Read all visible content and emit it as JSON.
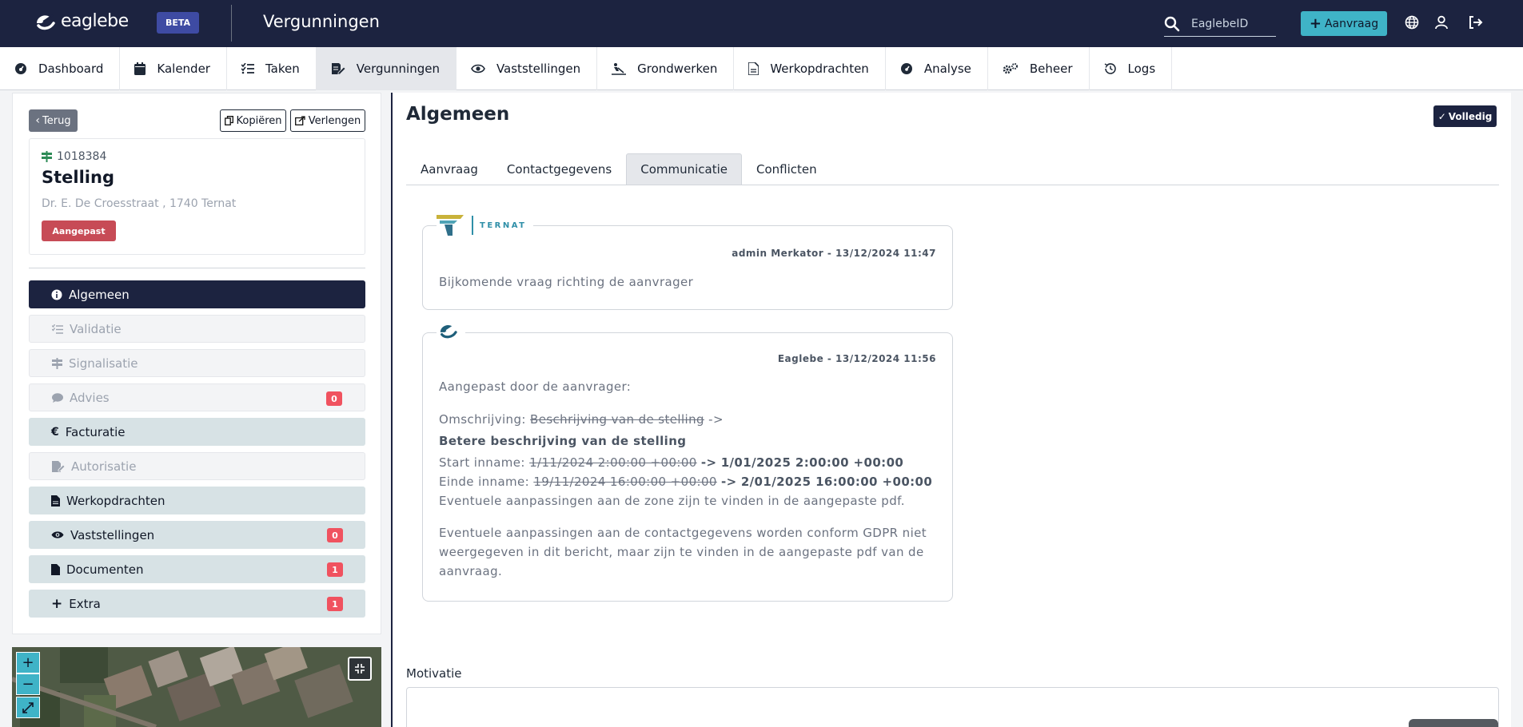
{
  "header": {
    "logo_text": "eaglebe",
    "beta_label": "BETA",
    "app_title": "Vergunningen",
    "search_placeholder": "EaglebeID",
    "aanvraag_button": "Aanvraag",
    "brand_color": "#1c2340",
    "accent_color": "#3fb3c7"
  },
  "nav": {
    "items": [
      {
        "label": "Dashboard",
        "icon": "dashboard-icon"
      },
      {
        "label": "Kalender",
        "icon": "calendar-icon"
      },
      {
        "label": "Taken",
        "icon": "tasks-icon"
      },
      {
        "label": "Vergunningen",
        "icon": "permit-icon",
        "active": true
      },
      {
        "label": "Vaststellingen",
        "icon": "eye-icon"
      },
      {
        "label": "Grondwerken",
        "icon": "digging-icon"
      },
      {
        "label": "Werkopdrachten",
        "icon": "file-icon"
      },
      {
        "label": "Analyse",
        "icon": "gauge-icon"
      },
      {
        "label": "Beheer",
        "icon": "cogs-icon"
      },
      {
        "label": "Logs",
        "icon": "history-icon"
      }
    ]
  },
  "left": {
    "terug_label": "Terug",
    "kopieren_label": "Kopiëren",
    "verlengen_label": "Verlengen",
    "card": {
      "id": "1018384",
      "title": "Stelling",
      "address": "Dr. E. De Croesstraat , 1740 Ternat",
      "status": "Aangepast"
    },
    "menu": [
      {
        "label": "Algemeen",
        "state": "active",
        "icon": "info-icon"
      },
      {
        "label": "Validatie",
        "state": "disabled",
        "icon": "checklist-icon"
      },
      {
        "label": "Signalisatie",
        "state": "disabled",
        "icon": "sign-icon"
      },
      {
        "label": "Advies",
        "state": "disabled",
        "icon": "comment-icon",
        "count": "0"
      },
      {
        "label": "Facturatie",
        "state": "enabled",
        "icon": "euro-icon"
      },
      {
        "label": "Autorisatie",
        "state": "disabled",
        "icon": "file-signature-icon"
      },
      {
        "label": "Werkopdrachten",
        "state": "enabled",
        "icon": "file-icon"
      },
      {
        "label": "Vaststellingen",
        "state": "enabled",
        "icon": "eye-icon",
        "count": "0"
      },
      {
        "label": "Documenten",
        "state": "enabled",
        "icon": "document-icon",
        "count": "1"
      },
      {
        "label": "Extra",
        "state": "enabled",
        "icon": "plus-icon",
        "count": "1"
      }
    ]
  },
  "map": {
    "zoom_in": "+",
    "zoom_out": "−"
  },
  "main": {
    "title": "Algemeen",
    "volledig_label": "Volledig",
    "tabs": [
      {
        "label": "Aanvraag"
      },
      {
        "label": "Contactgegevens"
      },
      {
        "label": "Communicatie",
        "active": true
      },
      {
        "label": "Conflicten"
      }
    ],
    "messages": [
      {
        "logo_text": "TERNAT",
        "meta": "admin Merkator - 13/12/2024 11:47",
        "body": "Bijkomende vraag richting de aanvrager"
      },
      {
        "meta": "Eaglebe - 13/12/2024 11:56",
        "intro": "Aangepast door de aanvrager:",
        "omschrijving_label": "Omschrijving:",
        "omschrijving_old": "Beschrijving van de stelling",
        "arrow": "->",
        "omschrijving_new": "Betere beschrijving van de stelling",
        "start_label": "Start inname:",
        "start_old": "1/11/2024 2:00:00 +00:00",
        "start_new": "1/01/2025 2:00:00 +00:00",
        "einde_label": "Einde inname:",
        "einde_old": "19/11/2024 16:00:00 +00:00",
        "einde_new": "2/01/2025 16:00:00 +00:00",
        "zone_note": "Eventuele aanpassingen aan de zone zijn te vinden in de aangepaste pdf.",
        "gdpr_note": "Eventuele aanpassingen aan de contactgegevens worden conform GDPR niet weergegeven in dit bericht, maar zijn te vinden in de aangepaste pdf van de aanvraag."
      }
    ],
    "motivatie_label": "Motivatie"
  }
}
